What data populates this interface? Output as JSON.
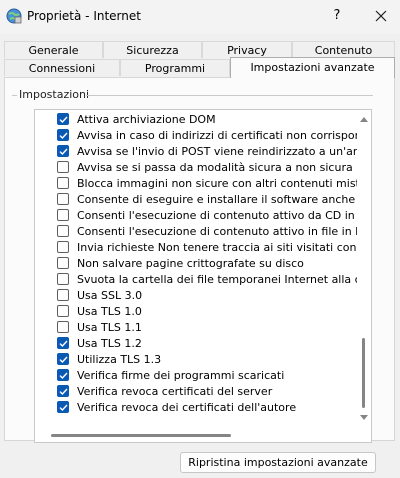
{
  "window": {
    "title": "Proprietà - Internet",
    "help_label": "?"
  },
  "tabs_back": [
    {
      "label": "Generale"
    },
    {
      "label": "Sicurezza"
    },
    {
      "label": "Privacy"
    },
    {
      "label": "Contenuto"
    }
  ],
  "tabs_front": [
    {
      "label": "Connessioni"
    },
    {
      "label": "Programmi"
    },
    {
      "label": "Impostazioni avanzate",
      "active": true
    }
  ],
  "group": {
    "label": "Impostazioni"
  },
  "settings": [
    {
      "label": "Attiva archiviazione DOM",
      "checked": true
    },
    {
      "label": "Avvisa in caso di indirizzi di certificati non corrispondenti",
      "checked": true
    },
    {
      "label": "Avvisa se l'invio di POST viene reindirizzato a un'area che n",
      "checked": true
    },
    {
      "label": "Avvisa se si passa da modalità sicura a non sicura",
      "checked": false
    },
    {
      "label": "Blocca immagini non sicure con altri contenuti misti",
      "checked": false
    },
    {
      "label": "Consente di eseguire e installare il software anche se la fir",
      "checked": false
    },
    {
      "label": "Consenti l'esecuzione di contenuto attivo da CD in Risorse",
      "checked": false
    },
    {
      "label": "Consenti l'esecuzione di contenuto attivo in file in Risorse c",
      "checked": false
    },
    {
      "label": "Invia richieste Non tenere traccia ai siti visitati con Interne",
      "checked": false
    },
    {
      "label": "Non salvare pagine crittografate su disco",
      "checked": false
    },
    {
      "label": "Svuota la cartella dei file temporanei Internet alla chiusura",
      "checked": false
    },
    {
      "label": "Usa SSL 3.0",
      "checked": false
    },
    {
      "label": "Usa TLS 1.0",
      "checked": false
    },
    {
      "label": "Usa TLS 1.1",
      "checked": false
    },
    {
      "label": "Usa TLS 1.2",
      "checked": true
    },
    {
      "label": "Utilizza TLS 1.3",
      "checked": true
    },
    {
      "label": "Verifica firme dei programmi scaricati",
      "checked": true
    },
    {
      "label": "Verifica revoca certificati del server",
      "checked": true
    },
    {
      "label": "Verifica revoca dei certificati dell'autore",
      "checked": true
    }
  ],
  "buttons": {
    "reset_label": "Ripristina impostazioni avanzate"
  },
  "colors": {
    "checkbox_checked": "#0a5ab4"
  }
}
